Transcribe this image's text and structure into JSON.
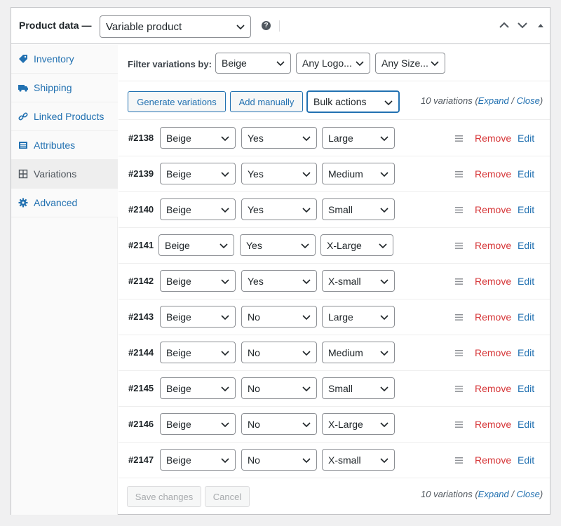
{
  "header": {
    "title": "Product data —",
    "product_type": "Variable product",
    "help_icon": "question-circle-icon",
    "collapse_up_icon": "chevron-up-icon",
    "collapse_down_icon": "chevron-down-icon",
    "toggle_icon": "triangle-up-icon"
  },
  "sidebar": {
    "items": [
      {
        "label": "Inventory",
        "icon": "tag-icon"
      },
      {
        "label": "Shipping",
        "icon": "truck-icon"
      },
      {
        "label": "Linked Products",
        "icon": "link-icon"
      },
      {
        "label": "Attributes",
        "icon": "list-icon"
      },
      {
        "label": "Variations",
        "icon": "grid-icon"
      },
      {
        "label": "Advanced",
        "icon": "gear-icon"
      }
    ],
    "active": "Variations"
  },
  "filter": {
    "label": "Filter variations by:",
    "color": "Beige",
    "logo": "Any Logo...",
    "size": "Any Size..."
  },
  "actions": {
    "generate": "Generate variations",
    "add_manually": "Add manually",
    "bulk": "Bulk actions",
    "count": "10 variations",
    "expand": "Expand",
    "sep": "/",
    "close": "Close"
  },
  "variations": [
    {
      "id": "#2138",
      "color": "Beige",
      "logo": "Yes",
      "size": "Large"
    },
    {
      "id": "#2139",
      "color": "Beige",
      "logo": "Yes",
      "size": "Medium"
    },
    {
      "id": "#2140",
      "color": "Beige",
      "logo": "Yes",
      "size": "Small"
    },
    {
      "id": "#2141",
      "color": "Beige",
      "logo": "Yes",
      "size": "X-Large"
    },
    {
      "id": "#2142",
      "color": "Beige",
      "logo": "Yes",
      "size": "X-small"
    },
    {
      "id": "#2143",
      "color": "Beige",
      "logo": "No",
      "size": "Large"
    },
    {
      "id": "#2144",
      "color": "Beige",
      "logo": "No",
      "size": "Medium"
    },
    {
      "id": "#2145",
      "color": "Beige",
      "logo": "No",
      "size": "Small"
    },
    {
      "id": "#2146",
      "color": "Beige",
      "logo": "No",
      "size": "X-Large"
    },
    {
      "id": "#2147",
      "color": "Beige",
      "logo": "No",
      "size": "X-small"
    }
  ],
  "row_actions": {
    "remove": "Remove",
    "edit": "Edit"
  },
  "footer": {
    "save": "Save changes",
    "cancel": "Cancel"
  },
  "colors": {
    "link": "#2271b1",
    "remove": "#d63638",
    "border": "#c3c4c7"
  }
}
